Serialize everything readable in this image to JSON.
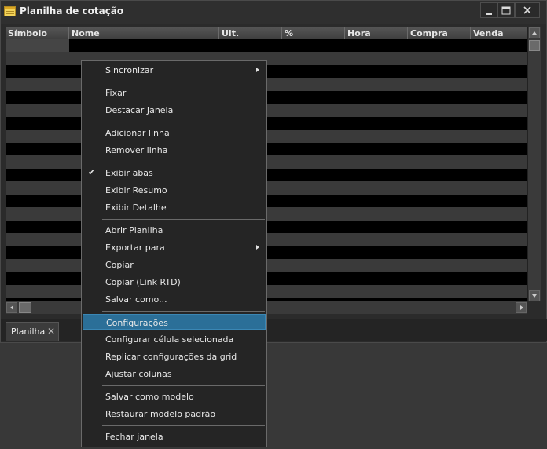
{
  "window": {
    "title": "Planilha de cotação"
  },
  "grid": {
    "columns": [
      "Símbolo",
      "Nome",
      "Ult.",
      "%",
      "Hora",
      "Compra",
      "Venda"
    ]
  },
  "tabs": [
    {
      "label": "Planilha"
    }
  ],
  "menu": {
    "items": [
      {
        "label": "Sincronizar",
        "submenu": true
      },
      {
        "label": "Fixar"
      },
      {
        "label": "Destacar Janela"
      },
      {
        "label": "Adicionar linha"
      },
      {
        "label": "Remover linha"
      },
      {
        "label": "Exibir abas",
        "checked": true
      },
      {
        "label": "Exibir Resumo"
      },
      {
        "label": "Exibir Detalhe"
      },
      {
        "label": "Abrir Planilha"
      },
      {
        "label": "Exportar para",
        "submenu": true
      },
      {
        "label": "Copiar"
      },
      {
        "label": "Copiar (Link RTD)"
      },
      {
        "label": "Salvar como..."
      },
      {
        "label": "Configurações",
        "highlighted": true
      },
      {
        "label": "Configurar célula selecionada"
      },
      {
        "label": "Replicar configurações da grid"
      },
      {
        "label": "Ajustar colunas"
      },
      {
        "label": "Salvar como modelo"
      },
      {
        "label": "Restaurar modelo padrão"
      },
      {
        "label": "Fechar janela"
      }
    ]
  },
  "colors": {
    "highlight": "#2b6f98",
    "row_dark": "#000000",
    "row_light": "#3a3a3a",
    "background": "#2b2b2b"
  }
}
